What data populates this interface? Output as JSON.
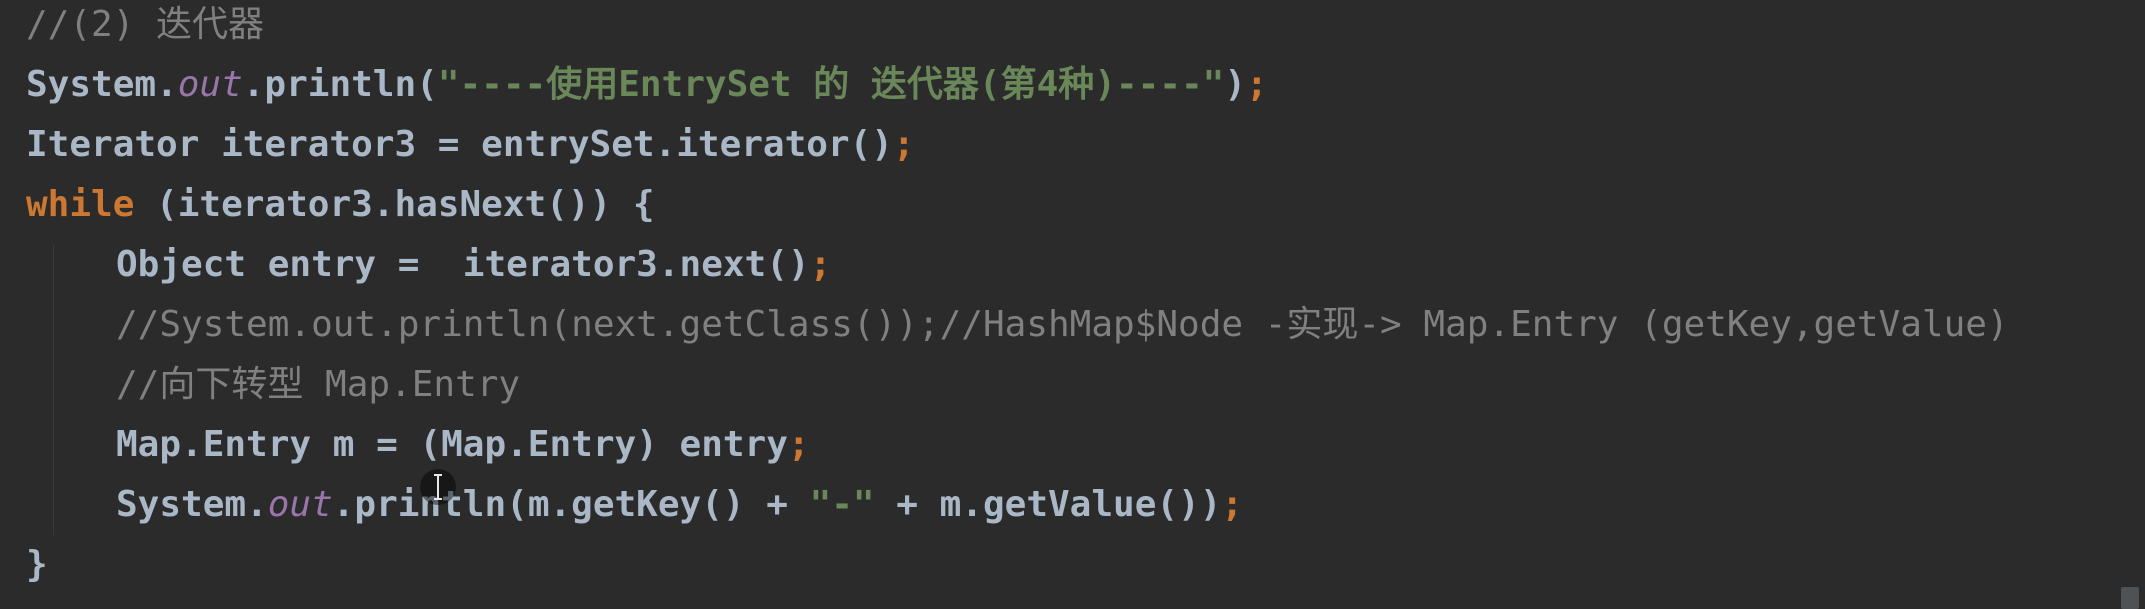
{
  "editor": {
    "lines": [
      {
        "indent": 0,
        "tokens": [
          {
            "t": "comment",
            "v": "//(2) 迭代器"
          }
        ]
      },
      {
        "indent": 0,
        "tokens": [
          {
            "t": "plain",
            "v": "System."
          },
          {
            "t": "field",
            "v": "out"
          },
          {
            "t": "plain",
            "v": ".println("
          },
          {
            "t": "string",
            "v": "\"----使用EntrySet 的 迭代器(第4种)----\""
          },
          {
            "t": "plain",
            "v": ")"
          },
          {
            "t": "punct",
            "v": ";"
          }
        ]
      },
      {
        "indent": 0,
        "tokens": [
          {
            "t": "plain",
            "v": "Iterator iterator3 = entrySet.iterator()"
          },
          {
            "t": "punct",
            "v": ";"
          }
        ]
      },
      {
        "indent": 0,
        "tokens": [
          {
            "t": "keyword",
            "v": "while"
          },
          {
            "t": "plain",
            "v": " (iterator3.hasNext()) {"
          }
        ]
      },
      {
        "indent": 1,
        "tokens": [
          {
            "t": "plain",
            "v": "Object entry =  iterator3.next()"
          },
          {
            "t": "punct",
            "v": ";"
          }
        ]
      },
      {
        "indent": 1,
        "tokens": [
          {
            "t": "comment",
            "v": "//System.out.println(next.getClass());//HashMap$Node -实现-> Map.Entry (getKey,getValue)"
          }
        ]
      },
      {
        "indent": 1,
        "tokens": [
          {
            "t": "comment",
            "v": "//向下转型 Map.Entry"
          }
        ]
      },
      {
        "indent": 1,
        "tokens": [
          {
            "t": "plain",
            "v": "Map.Entry m = (Map.Entry) entry"
          },
          {
            "t": "punct",
            "v": ";"
          }
        ]
      },
      {
        "indent": 1,
        "tokens": [
          {
            "t": "plain",
            "v": "System."
          },
          {
            "t": "field",
            "v": "out"
          },
          {
            "t": "plain",
            "v": ".println(m.getKey() + "
          },
          {
            "t": "string",
            "v": "\"-\""
          },
          {
            "t": "plain",
            "v": " + m.getValue())"
          },
          {
            "t": "punct",
            "v": ";"
          }
        ]
      },
      {
        "indent": 0,
        "tokens": [
          {
            "t": "plain",
            "v": "}"
          }
        ]
      }
    ]
  },
  "colors": {
    "background": "#2b2b2b",
    "plain": "#a9b7c6",
    "keyword": "#cc7832",
    "string": "#6a8759",
    "comment": "#808080",
    "field": "#9876aa"
  },
  "icons": {
    "cursor": "text-cursor-icon"
  }
}
